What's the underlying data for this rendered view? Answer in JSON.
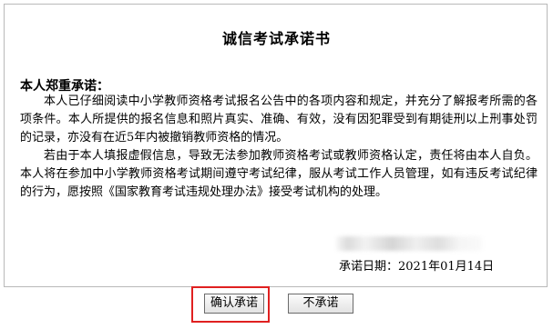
{
  "document": {
    "title": "诚信考试承诺书",
    "heading": "本人郑重承诺：",
    "paragraphs": [
      "本人已仔细阅读中小学教师资格考试报名公告中的各项内容和规定，并充分了解报考所需的各项条件。本人所提供的报名信息和照片真实、准确、有效，没有因犯罪受到有期徒刑以上刑事处罚的记录，亦没有在近5年内被撤销教师资格的情况。",
      "若由于本人填报虚假信息，导致无法参加教师资格考试或教师资格认定，责任将由本人自负。本人将在参加中小学教师资格考试期间遵守考试纪律，服从考试工作人员管理，如有违反考试纪律的行为，愿按照《国家教育考试违规处理办法》接受考试机构的处理。"
    ],
    "date_line": "承诺日期：2021年01月14日"
  },
  "actions": {
    "confirm_label": "确认承诺",
    "decline_label": "不承诺"
  },
  "colors": {
    "highlight": "#e02020",
    "border": "#b9b9b9"
  }
}
